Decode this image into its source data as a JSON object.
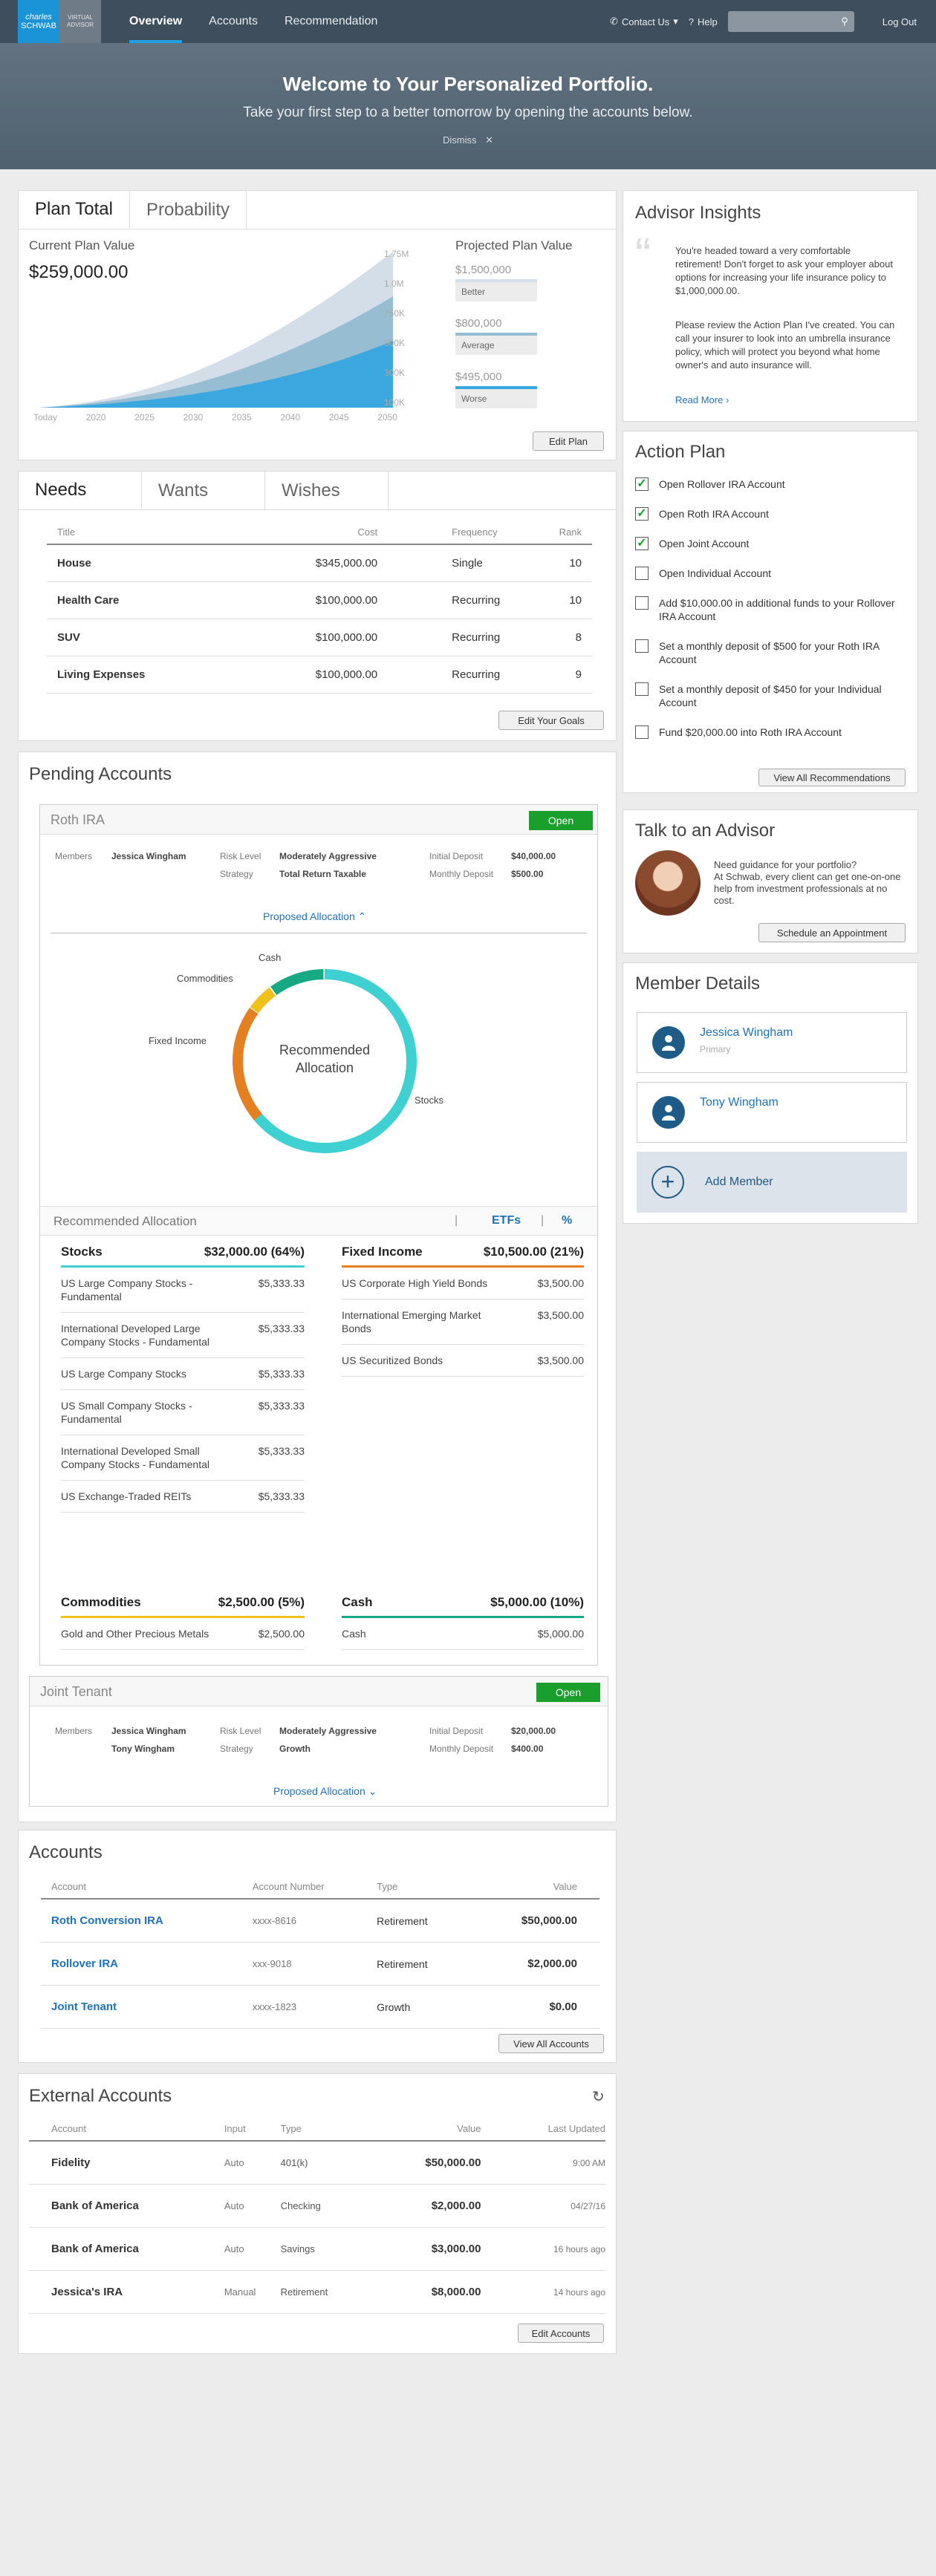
{
  "nav": {
    "logo_top": "charles",
    "logo_bottom": "SCHWAB",
    "logo2_top": "VIRTUAL",
    "logo2_bottom": "ADVISOR",
    "links": [
      "Overview",
      "Accounts",
      "Recommendation"
    ],
    "contact": "Contact Us",
    "help": "Help",
    "logout": "Log Out"
  },
  "hero": {
    "title": "Welcome to Your Personalized Portfolio.",
    "subtitle": "Take your first step to a better tomorrow by opening the accounts below.",
    "dismiss": "Dismiss"
  },
  "plan": {
    "tabs": [
      "Plan Total",
      "Probability"
    ],
    "current_label": "Current Plan Value",
    "current_value": "$259,000.00",
    "y_ticks": [
      "1.75M",
      "1.0M",
      "750K",
      "500K",
      "300K",
      "100K"
    ],
    "x_ticks": [
      "Today",
      "2020",
      "2025",
      "2030",
      "2035",
      "2040",
      "2045",
      "2050"
    ],
    "projected_label": "Projected Plan Value",
    "projections": [
      {
        "value": "$1,500,000",
        "label": "Better"
      },
      {
        "value": "$800,000",
        "label": "Average"
      },
      {
        "value": "$495,000",
        "label": "Worse"
      }
    ],
    "edit_button": "Edit Plan"
  },
  "goals": {
    "tabs": [
      "Needs",
      "Wants",
      "Wishes"
    ],
    "headers": [
      "Title",
      "Cost",
      "Frequency",
      "Rank"
    ],
    "rows": [
      {
        "title": "House",
        "cost": "$345,000.00",
        "frequency": "Single",
        "rank": "10"
      },
      {
        "title": "Health Care",
        "cost": "$100,000.00",
        "frequency": "Recurring",
        "rank": "10"
      },
      {
        "title": "SUV",
        "cost": "$100,000.00",
        "frequency": "Recurring",
        "rank": "8"
      },
      {
        "title": "Living Expenses",
        "cost": "$100,000.00",
        "frequency": "Recurring",
        "rank": "9"
      }
    ],
    "edit_button": "Edit Your Goals"
  },
  "pending": {
    "title": "Pending Accounts",
    "roth": {
      "name": "Roth IRA",
      "open": "Open",
      "members_label": "Members",
      "members": "Jessica Wingham",
      "risk_label": "Risk Level",
      "risk": "Moderately Aggressive",
      "strategy_label": "Strategy",
      "strategy": "Total Return Taxable",
      "deposit_label": "Initial Deposit",
      "deposit": "$40,000.00",
      "monthly_label": "Monthly Deposit",
      "monthly": "$500.00",
      "proposed": "Proposed Allocation"
    },
    "donut": {
      "center": "Recommended Allocation",
      "labels": [
        "Cash",
        "Commodities",
        "Fixed Income",
        "Stocks"
      ]
    },
    "rec": {
      "title": "Recommended Allocation",
      "etfs": "ETFs",
      "pct": "%",
      "stocks": {
        "name": "Stocks",
        "total": "$32,000.00 (64%)",
        "items": [
          [
            "US Large Company Stocks - Fundamental",
            "$5,333.33"
          ],
          [
            "International Developed Large Company Stocks - Fundamental",
            "$5,333.33"
          ],
          [
            "US Large Company Stocks",
            "$5,333.33"
          ],
          [
            "US Small Company Stocks - Fundamental",
            "$5,333.33"
          ],
          [
            "International Developed Small Company Stocks - Fundamental",
            "$5,333.33"
          ],
          [
            "US Exchange-Traded REITs",
            "$5,333.33"
          ]
        ]
      },
      "fixed": {
        "name": "Fixed Income",
        "total": "$10,500.00 (21%)",
        "items": [
          [
            "US Corporate High Yield Bonds",
            "$3,500.00"
          ],
          [
            "International Emerging Market Bonds",
            "$3,500.00"
          ],
          [
            "US Securitized Bonds",
            "$3,500.00"
          ]
        ]
      },
      "commodities": {
        "name": "Commodities",
        "total": "$2,500.00 (5%)",
        "items": [
          [
            "Gold and Other Precious Metals",
            "$2,500.00"
          ]
        ]
      },
      "cash": {
        "name": "Cash",
        "total": "$5,000.00 (10%)",
        "items": [
          [
            "Cash",
            "$5,000.00"
          ]
        ]
      }
    },
    "joint": {
      "name": "Joint Tenant",
      "open": "Open",
      "members_label": "Members",
      "member1": "Jessica Wingham",
      "member2": "Tony Wingham",
      "risk_label": "Risk Level",
      "risk": "Moderately Aggressive",
      "strategy_label": "Strategy",
      "strategy": "Growth",
      "deposit_label": "Initial Deposit",
      "deposit": "$20,000.00",
      "monthly_label": "Monthly Deposit",
      "monthly": "$400.00",
      "proposed": "Proposed Allocation"
    }
  },
  "accounts": {
    "title": "Accounts",
    "headers": [
      "Account",
      "Account Number",
      "Type",
      "Value"
    ],
    "rows": [
      {
        "name": "Roth Conversion IRA",
        "number": "xxxx-8616",
        "type": "Retirement",
        "value": "$50,000.00"
      },
      {
        "name": "Rollover IRA",
        "number": "xxx-9018",
        "type": "Retirement",
        "value": "$2,000.00"
      },
      {
        "name": "Joint Tenant",
        "number": "xxxx-1823",
        "type": "Growth",
        "value": "$0.00"
      }
    ],
    "button": "View All Accounts"
  },
  "external": {
    "title": "External Accounts",
    "headers": [
      "Account",
      "Input",
      "Type",
      "Value",
      "Last Updated"
    ],
    "rows": [
      {
        "name": "Fidelity",
        "input": "Auto",
        "type": "401(k)",
        "value": "$50,000.00",
        "updated": "9:00 AM"
      },
      {
        "name": "Bank of America",
        "input": "Auto",
        "type": "Checking",
        "value": "$2,000.00",
        "updated": "04/27/16"
      },
      {
        "name": "Bank of America",
        "input": "Auto",
        "type": "Savings",
        "value": "$3,000.00",
        "updated": "16 hours ago"
      },
      {
        "name": "Jessica's IRA",
        "input": "Manual",
        "type": "Retirement",
        "value": "$8,000.00",
        "updated": "14 hours ago"
      }
    ],
    "button": "Edit Accounts"
  },
  "insights": {
    "title": "Advisor Insights",
    "p1": "You're headed toward a very comfortable retirement! Don't forget to ask your employer about options for increasing your life insurance policy to $1,000,000.00.",
    "p2": "Please review the Action Plan I've created. You can call your insurer to look into an umbrella insurance policy, which will protect you beyond what home owner's and auto insurance will.",
    "read_more": "Read More"
  },
  "action": {
    "title": "Action Plan",
    "items": [
      {
        "text": "Open Rollover IRA Account",
        "checked": "✓"
      },
      {
        "text": "Open Roth IRA Account",
        "checked": "✓"
      },
      {
        "text": "Open Joint Account",
        "checked": "✓"
      },
      {
        "text": "Open Individual Account",
        "checked": ""
      },
      {
        "text": "Add $10,000.00 in additional funds to your Rollover IRA Account",
        "checked": ""
      },
      {
        "text": "Set a monthly deposit of $500 for your Roth IRA Account",
        "checked": ""
      },
      {
        "text": "Set a monthly deposit of $450 for your Individual Account",
        "checked": ""
      },
      {
        "text": "Fund $20,000.00 into Roth IRA Account",
        "checked": ""
      }
    ],
    "button": "View All Recommendations"
  },
  "advisor": {
    "title": "Talk to an Advisor",
    "text1": "Need guidance for your portfolio?",
    "text2": "At Schwab, every client can get one-on-one help from investment professionals at no cost.",
    "button": "Schedule an Appointment"
  },
  "members": {
    "title": "Member Details",
    "m1": "Jessica Wingham",
    "m1_role": "Primary",
    "m2": "Tony Wingham",
    "add": "Add Member"
  },
  "colors": {
    "nav": "#3e4e5c",
    "accent": "#21a1e2",
    "green": "#1a9e2c",
    "stocks": "#3fd1d1",
    "fixed": "#e47f22",
    "commodities": "#f0c11a",
    "cash": "#17a884"
  }
}
